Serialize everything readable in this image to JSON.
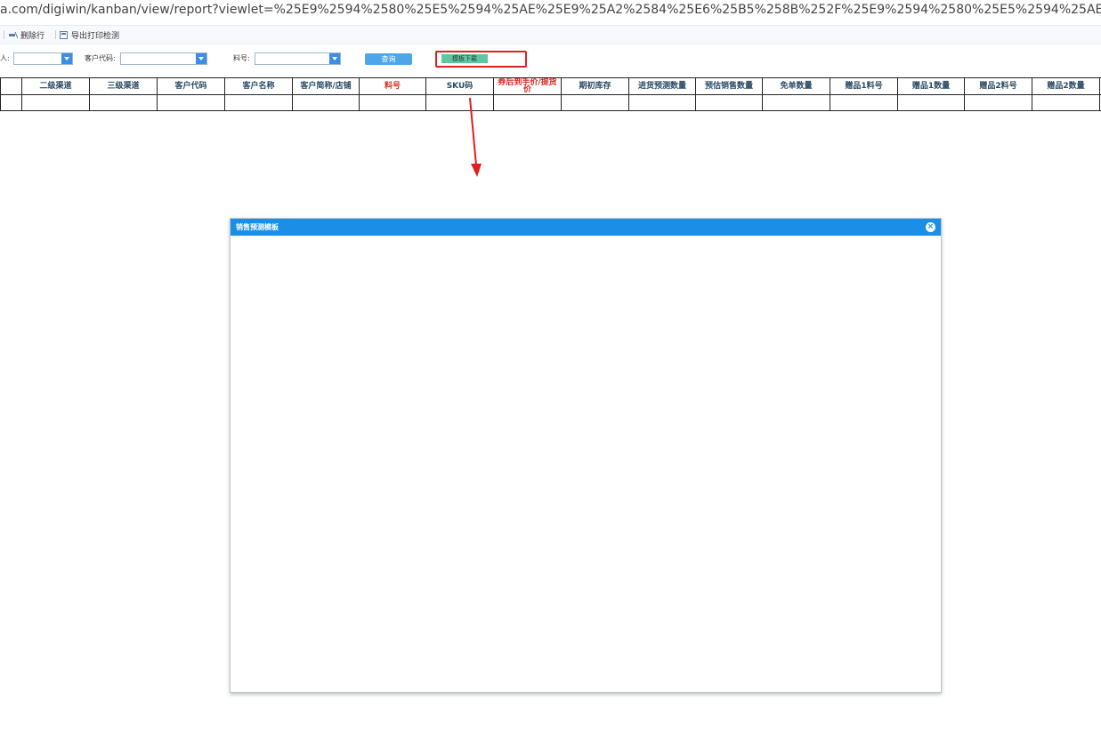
{
  "browser": {
    "url": "a.com/digiwin/kanban/view/report?viewlet=%25E9%2594%2580%25E5%2594%25AE%25E9%25A2%2584%25E6%25B5%258B%252F%25E9%2594%2580%25E5%2594%25AE%25E9%25A2%2584%25."
  },
  "toolbar": {
    "delete_row_label": "删除行",
    "export_label": "导出打印检测"
  },
  "filters": {
    "person_label": "人:",
    "person_value": "",
    "customer_code_label": "客户代码:",
    "customer_code_value": "",
    "item_no_label": "料号:",
    "item_no_value": ""
  },
  "buttons": {
    "query_label": "查询",
    "template_download_label": "模板下载"
  },
  "table": {
    "columns": [
      {
        "label": "",
        "red": false
      },
      {
        "label": "二级渠道",
        "red": false
      },
      {
        "label": "三级渠道",
        "red": false
      },
      {
        "label": "客户代码",
        "red": false
      },
      {
        "label": "客户名称",
        "red": false
      },
      {
        "label": "客户简称/店铺",
        "red": false
      },
      {
        "label": "料号",
        "red": true
      },
      {
        "label": "SKU码",
        "red": false
      },
      {
        "label": "券后到手价/提货价",
        "red": true
      },
      {
        "label": "期初库存",
        "red": false
      },
      {
        "label": "进货预测数量",
        "red": false
      },
      {
        "label": "预估销售数量",
        "red": false
      },
      {
        "label": "免单数量",
        "red": false
      },
      {
        "label": "赠品1料号",
        "red": false
      },
      {
        "label": "赠品1数量",
        "red": false
      },
      {
        "label": "赠品2料号",
        "red": false
      },
      {
        "label": "赠品2数量",
        "red": false
      },
      {
        "label": "",
        "red": false
      }
    ]
  },
  "dialog": {
    "title": "销售预测模板"
  },
  "colors": {
    "dialog_header": "#1b8fe6",
    "highlight": "#e02020",
    "download_button": "#5ec6a0",
    "query_button": "#4ea6ea"
  }
}
